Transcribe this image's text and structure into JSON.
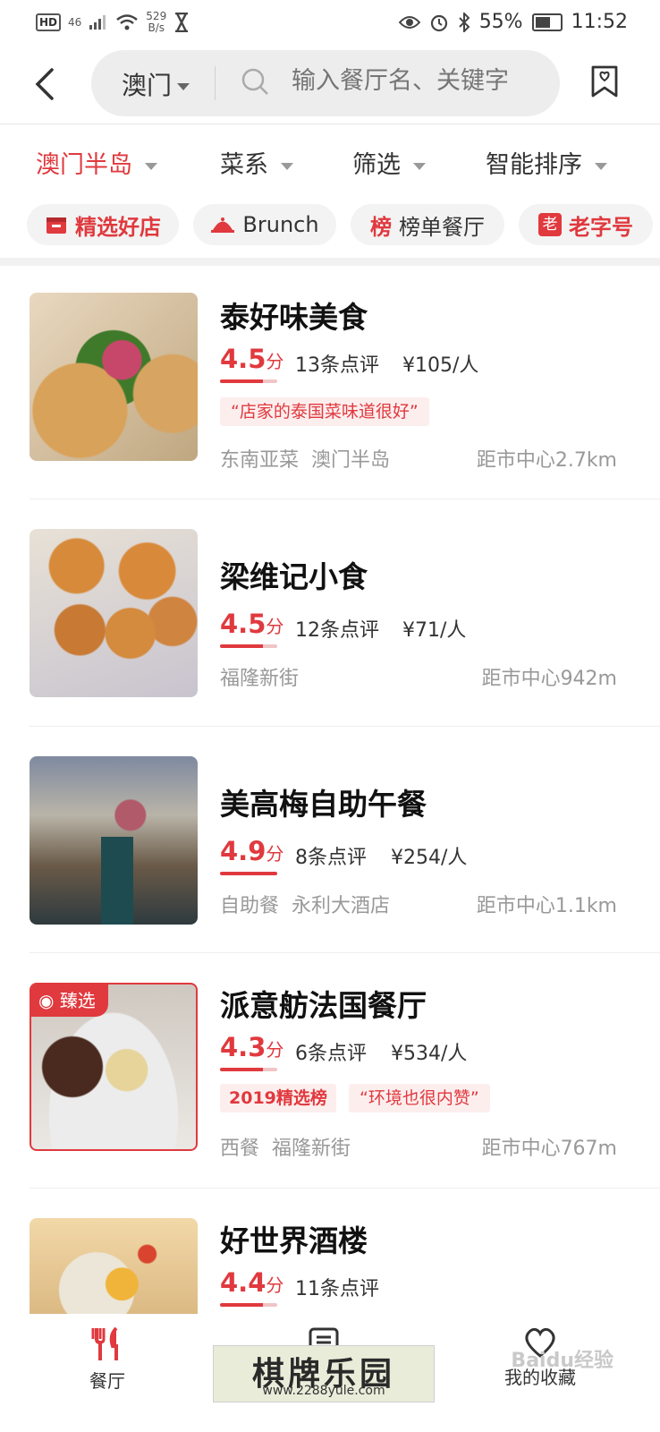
{
  "status": {
    "network": "46",
    "speed_value": "529",
    "speed_unit": "B/s",
    "battery": "55%",
    "time": "11:52"
  },
  "header": {
    "city": "澳门",
    "search_placeholder": "输入餐厅名、关键字"
  },
  "filters": [
    "澳门半岛",
    "菜系",
    "筛选",
    "智能排序"
  ],
  "tags": [
    {
      "label": "精选好店"
    },
    {
      "label": "Brunch"
    },
    {
      "label": "榜单餐厅"
    },
    {
      "label": "老字号"
    }
  ],
  "restaurants": [
    {
      "name": "泰好味美食",
      "rating": "4.5",
      "score_unit": "分",
      "reviews": "13条点评",
      "price": "¥105/人",
      "quote": "“店家的泰国菜味道很好”",
      "cuisine": "东南亚菜",
      "area": "澳门半岛",
      "distance": "距市中心2.7km"
    },
    {
      "name": "梁维记小食",
      "rating": "4.5",
      "score_unit": "分",
      "reviews": "12条点评",
      "price": "¥71/人",
      "area": "福隆新街",
      "distance": "距市中心942m"
    },
    {
      "name": "美高梅自助午餐",
      "rating": "4.9",
      "score_unit": "分",
      "reviews": "8条点评",
      "price": "¥254/人",
      "cuisine": "自助餐",
      "area": "永利大酒店",
      "distance": "距市中心1.1km"
    },
    {
      "name": "派意舫法国餐厅",
      "rating": "4.3",
      "score_unit": "分",
      "reviews": "6条点评",
      "price": "¥534/人",
      "badge": "2019精选榜",
      "quote": "“环境也很内赞”",
      "cuisine": "西餐",
      "area": "福隆新街",
      "distance": "距市中心767m",
      "ribbon": "臻选"
    },
    {
      "name": "好世界酒楼",
      "rating": "4.4",
      "score_unit": "分",
      "reviews": "11条点评"
    }
  ],
  "bottom_nav": {
    "restaurant": "餐厅",
    "favorites": "我的收藏"
  },
  "watermark": {
    "title": "棋牌乐园",
    "url": "www.2288yule.com",
    "baidu": "Baidu经验"
  },
  "colors": {
    "accent": "#e0393e",
    "tag_bg": "#f3f3f3"
  }
}
